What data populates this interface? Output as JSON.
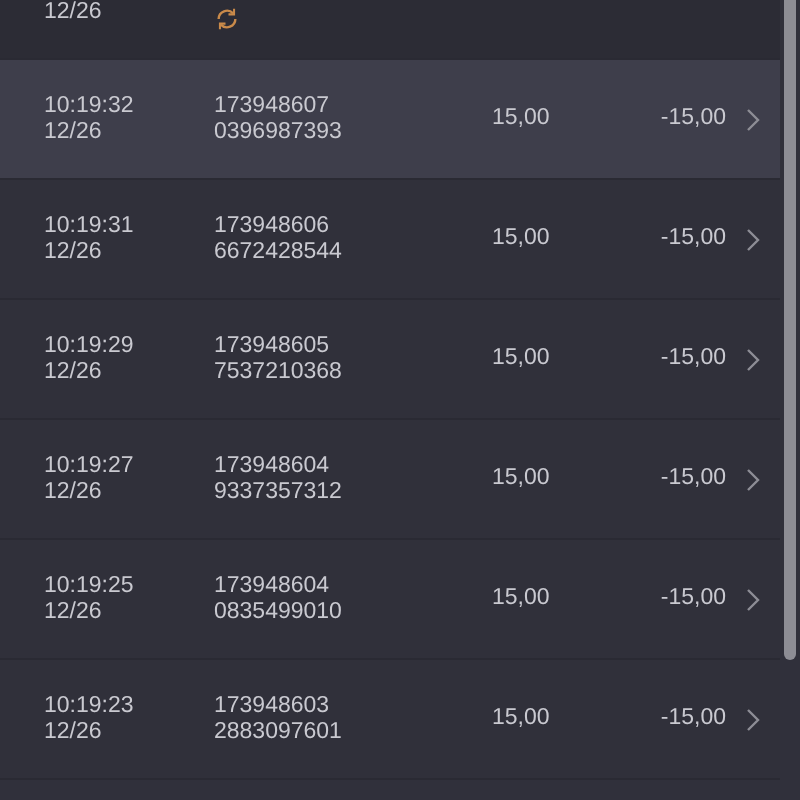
{
  "partial_row": {
    "date": "12/26",
    "pending": true
  },
  "rows": [
    {
      "time": "10:19:32",
      "date": "12/26",
      "id": "173948607",
      "ref": "0396987393",
      "amount": "15,00",
      "balance": "-15,00",
      "highlighted": true
    },
    {
      "time": "10:19:31",
      "date": "12/26",
      "id": "173948606",
      "ref": "6672428544",
      "amount": "15,00",
      "balance": "-15,00",
      "highlighted": false
    },
    {
      "time": "10:19:29",
      "date": "12/26",
      "id": "173948605",
      "ref": "7537210368",
      "amount": "15,00",
      "balance": "-15,00",
      "highlighted": false
    },
    {
      "time": "10:19:27",
      "date": "12/26",
      "id": "173948604",
      "ref": "9337357312",
      "amount": "15,00",
      "balance": "-15,00",
      "highlighted": false
    },
    {
      "time": "10:19:25",
      "date": "12/26",
      "id": "173948604",
      "ref": "0835499010",
      "amount": "15,00",
      "balance": "-15,00",
      "highlighted": false
    },
    {
      "time": "10:19:23",
      "date": "12/26",
      "id": "173948603",
      "ref": "2883097601",
      "amount": "15,00",
      "balance": "-15,00",
      "highlighted": false
    }
  ]
}
